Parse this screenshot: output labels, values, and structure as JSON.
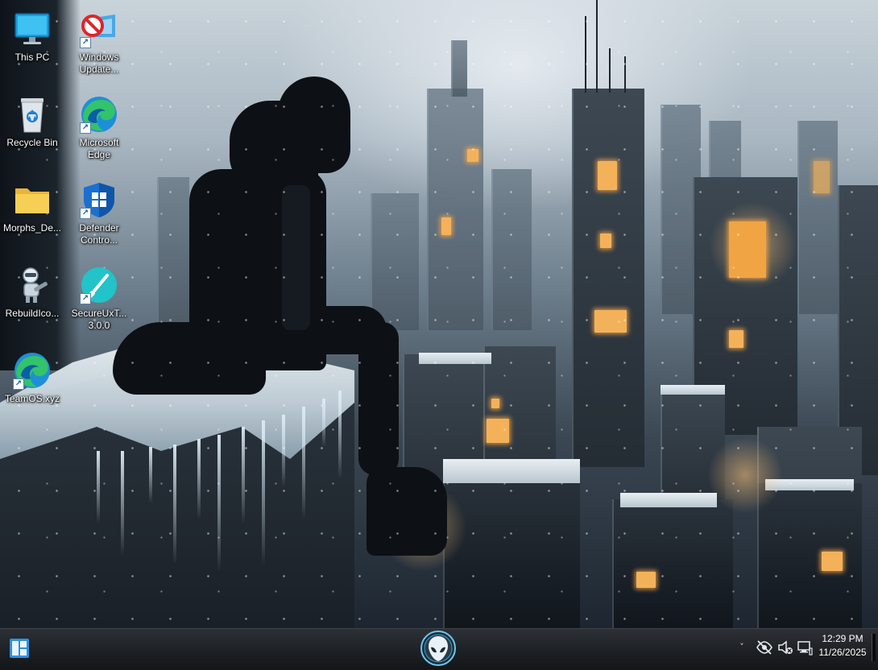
{
  "desktop": {
    "icons": [
      {
        "label": "This PC",
        "icon": "monitor-icon"
      },
      {
        "label": "Windows\nUpdate...",
        "icon": "windows-update-blocker-icon",
        "shortcut": true
      },
      {
        "label": "Recycle Bin",
        "icon": "recycle-bin-icon"
      },
      {
        "label": "Microsoft\nEdge",
        "icon": "edge-icon",
        "shortcut": true
      },
      {
        "label": "Morphs_De...",
        "icon": "folder-icon"
      },
      {
        "label": "Defender\nContro...",
        "icon": "defender-shield-icon",
        "shortcut": true
      },
      {
        "label": "RebuildIco...",
        "icon": "robot-icon"
      },
      {
        "label": "SecureUxT...\n3.0.0",
        "icon": "brush-icon",
        "shortcut": true
      },
      {
        "label": "TeamOS.xyz",
        "icon": "edge-icon",
        "shortcut": true
      }
    ]
  },
  "taskbar": {
    "start_icon": "start-icon",
    "center_icon": "alienware-icon",
    "tray": {
      "chevron": "˅",
      "icons": [
        "eye-off-icon",
        "speaker-muted-icon",
        "network-icon"
      ]
    },
    "clock": {
      "time": "12:29 PM",
      "date": "11/26/2025"
    }
  },
  "colors": {
    "taskbar_bg": "#1d2024",
    "icon_label": "#ffffff",
    "window_glow": "#f3b25a"
  }
}
